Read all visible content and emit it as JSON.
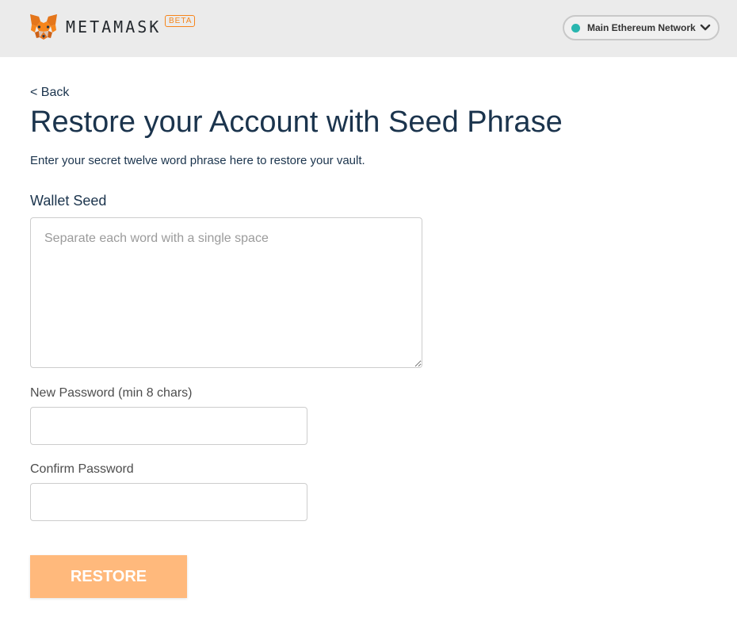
{
  "header": {
    "brand_name": "METAMASK",
    "beta_badge": "BETA",
    "network": {
      "label": "Main Ethereum Network",
      "status_color": "#29b6af"
    },
    "logo_icon": "metamask-fox-icon",
    "dropdown_icon": "chevron-down-icon"
  },
  "page": {
    "back_label": "< Back",
    "title": "Restore your Account with Seed Phrase",
    "subtitle": "Enter your secret twelve word phrase here to restore your vault."
  },
  "form": {
    "seed_label": "Wallet Seed",
    "seed_placeholder": "Separate each word with a single space",
    "seed_value": "",
    "new_password_label": "New Password (min 8 chars)",
    "new_password_value": "",
    "confirm_password_label": "Confirm Password",
    "confirm_password_value": "",
    "restore_label": "RESTORE"
  },
  "colors": {
    "header_bg": "#ebebeb",
    "accent_orange": "#f6851b",
    "button_bg": "#ffb97c",
    "text_dark": "#1b344d"
  }
}
